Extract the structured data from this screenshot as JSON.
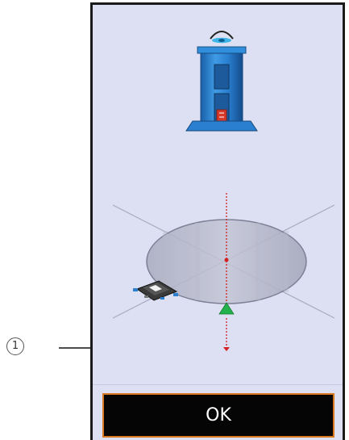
{
  "callout": {
    "number": "1"
  },
  "dialog": {
    "ok_label": "OK"
  },
  "colors": {
    "panel_bg": "#dde0f2",
    "button_bg": "#050505",
    "button_border": "#d97a22",
    "marker_green": "#22b24c",
    "axis_red": "#d42020",
    "column_blue": "#2a7fd0"
  },
  "icons": {
    "eye": "eye-icon",
    "column": "column-unit-icon",
    "wafer": "wafer-disc-icon",
    "component": "component-chip-icon",
    "marker": "green-triangle-marker-icon"
  }
}
